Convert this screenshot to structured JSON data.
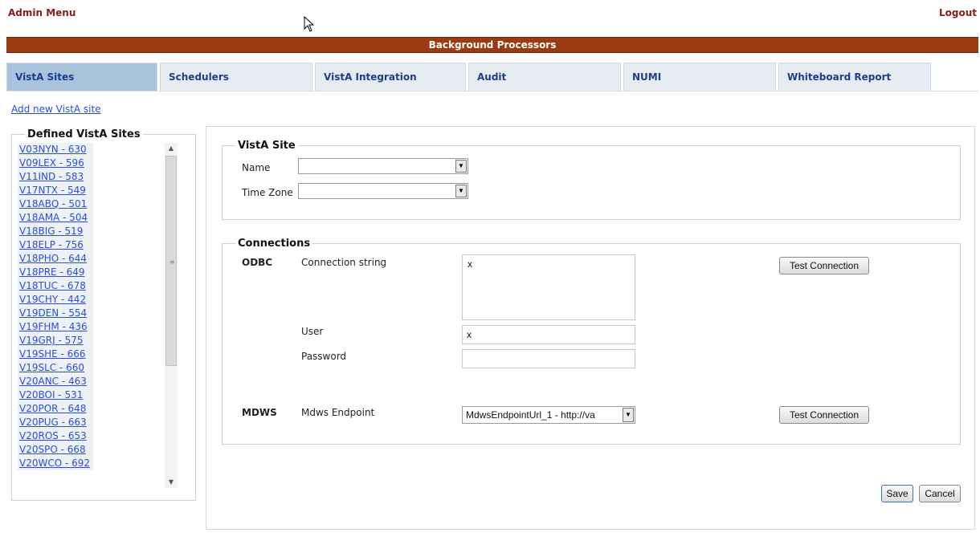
{
  "header": {
    "admin_menu": "Admin Menu",
    "logout": "Logout",
    "title": "Background Processors",
    "title_color": "#9c3a12"
  },
  "tabs": [
    {
      "label": "VistA Sites",
      "active": true
    },
    {
      "label": "Schedulers",
      "active": false
    },
    {
      "label": "VistA Integration",
      "active": false
    },
    {
      "label": "Audit",
      "active": false
    },
    {
      "label": "NUMI",
      "active": false
    },
    {
      "label": "Whiteboard Report",
      "active": false
    }
  ],
  "add_site_link": "Add new VistA site",
  "sites_panel": {
    "legend": "Defined VistA Sites",
    "items": [
      "V03NYN - 630",
      "V09LEX - 596",
      "V11IND - 583",
      "V17NTX - 549",
      "V18ABQ - 501",
      "V18AMA - 504",
      "V18BIG - 519",
      "V18ELP - 756",
      "V18PHO - 644",
      "V18PRE - 649",
      "V18TUC - 678",
      "V19CHY - 442",
      "V19DEN - 554",
      "V19FHM - 436",
      "V19GRJ - 575",
      "V19SHE - 666",
      "V19SLC - 660",
      "V20ANC - 463",
      "V20BOI - 531",
      "V20POR - 648",
      "V20PUG - 663",
      "V20ROS - 653",
      "V20SPO - 668",
      "V20WCO - 692"
    ]
  },
  "vista_site": {
    "legend": "VistA Site",
    "name_label": "Name",
    "name_value": "",
    "timezone_label": "Time Zone",
    "timezone_value": ""
  },
  "connections": {
    "legend": "Connections",
    "odbc_label": "ODBC",
    "connection_string_label": "Connection string",
    "connection_string_value": "x",
    "user_label": "User",
    "user_value": "x",
    "password_label": "Password",
    "password_value": "",
    "test_connection_label": "Test Connection",
    "mdws_label": "MDWS",
    "mdws_endpoint_label": "Mdws Endpoint",
    "mdws_endpoint_value": "MdwsEndpointUrl_1 - http://va",
    "test_connection_label_2": "Test Connection"
  },
  "actions": {
    "save": "Save",
    "cancel": "Cancel"
  }
}
